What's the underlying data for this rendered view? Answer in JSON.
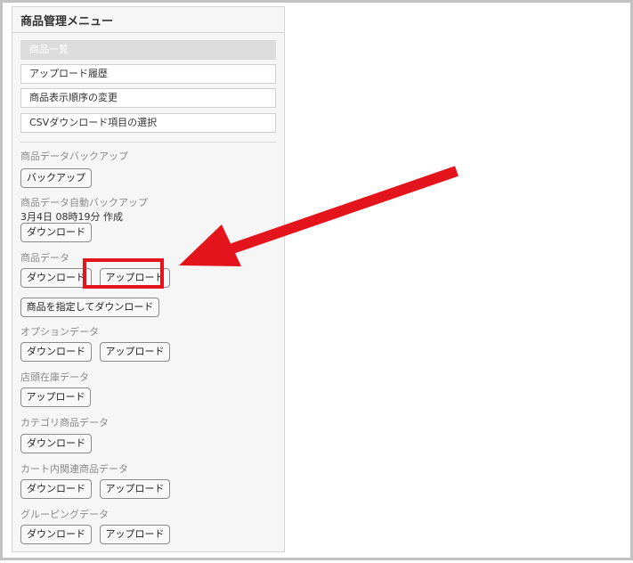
{
  "panel": {
    "title": "商品管理メニュー",
    "menu": [
      {
        "label": "商品一覧",
        "active": true
      },
      {
        "label": "アップロード履歴",
        "active": false
      },
      {
        "label": "商品表示順序の変更",
        "active": false
      },
      {
        "label": "CSVダウンロード項目の選択",
        "active": false
      }
    ]
  },
  "sections": {
    "backup": {
      "label": "商品データバックアップ",
      "button": "バックアップ"
    },
    "auto_backup": {
      "label": "商品データ自動バックアップ",
      "info": "3月4日 08時19分 作成",
      "download": "ダウンロード"
    },
    "product_data": {
      "label": "商品データ",
      "download": "ダウンロード",
      "upload": "アップロード",
      "specified_download": "商品を指定してダウンロード"
    },
    "option_data": {
      "label": "オプションデータ",
      "download": "ダウンロード",
      "upload": "アップロード"
    },
    "store_stock": {
      "label": "店頭在庫データ",
      "upload": "アップロード"
    },
    "category_data": {
      "label": "カテゴリ商品データ",
      "download": "ダウンロード"
    },
    "cart_related": {
      "label": "カート内関連商品データ",
      "download": "ダウンロード",
      "upload": "アップロード"
    },
    "grouping": {
      "label": "グルーピングデータ",
      "download": "ダウンロード",
      "upload": "アップロード"
    }
  },
  "annotation": {
    "color": "#e3141b"
  }
}
